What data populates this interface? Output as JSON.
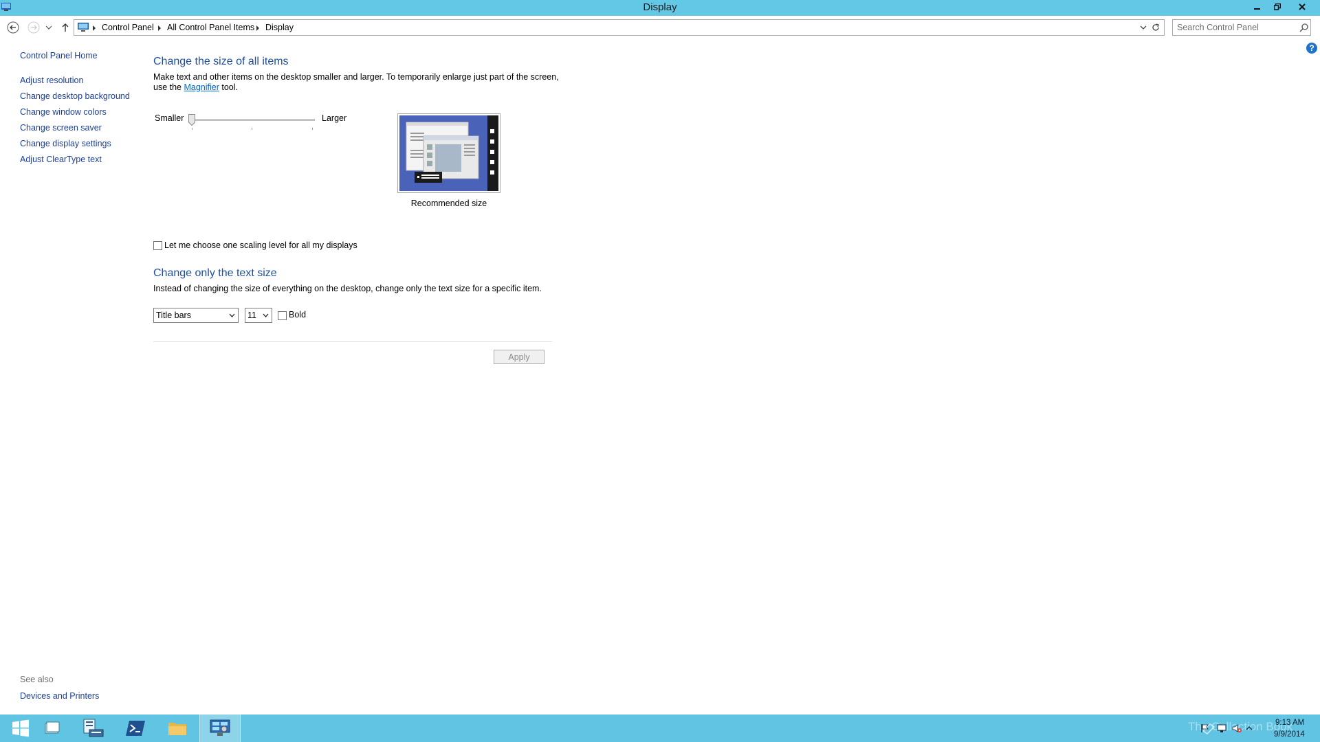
{
  "window": {
    "title": "Display",
    "accent_color": "#63c7e6"
  },
  "address": {
    "crumbs": [
      "Control Panel",
      "All Control Panel Items",
      "Display"
    ],
    "search_placeholder": "Search Control Panel"
  },
  "left_pane": {
    "home": "Control Panel Home",
    "links": [
      "Adjust resolution",
      "Change desktop background",
      "Change window colors",
      "Change screen saver",
      "Change display settings",
      "Adjust ClearType text"
    ],
    "see_also_label": "See also",
    "see_also_links": [
      "Devices and Printers"
    ]
  },
  "size_section": {
    "heading": "Change the size of all items",
    "desc_line1": "Make text and other items on the desktop smaller and larger. To temporarily enlarge just part of the screen,",
    "desc_line2_prefix": "use the ",
    "desc_link": "Magnifier",
    "desc_line2_suffix": " tool.",
    "slider_smaller": "Smaller",
    "slider_larger": "Larger",
    "slider_position": 0,
    "preview_caption": "Recommended size",
    "scaling_checkbox_label": "Let me choose one scaling level for all my displays",
    "scaling_checked": false
  },
  "text_section": {
    "heading": "Change only the text size",
    "desc": "Instead of changing the size of everything on the desktop, change only the text size for a specific item.",
    "item_select": "Title bars",
    "size_select": "11",
    "bold_label": "Bold",
    "bold_checked": false
  },
  "apply_label": "Apply",
  "taskbar": {
    "watermark": "The Collection Book",
    "time": "9:13 AM",
    "date": "9/9/2014"
  }
}
